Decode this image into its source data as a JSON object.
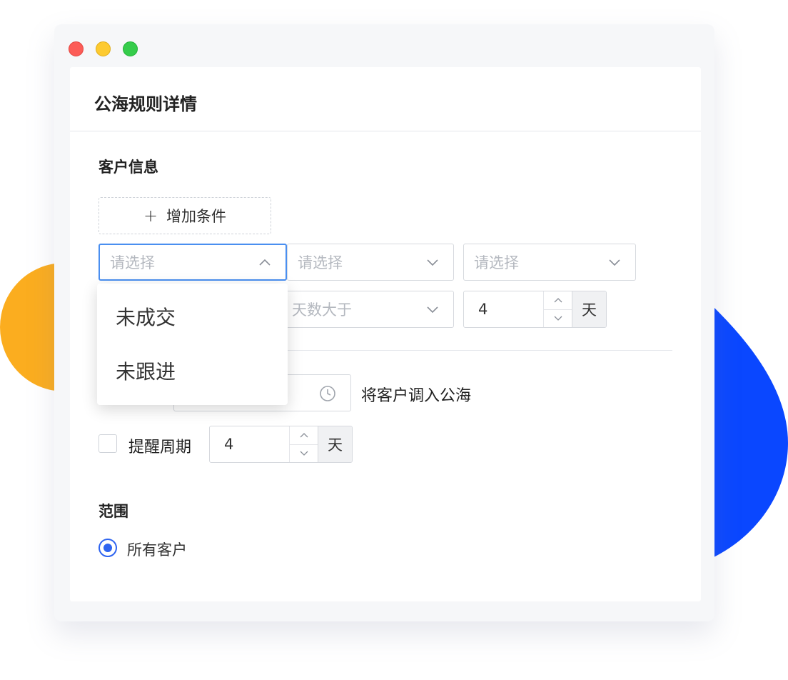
{
  "window": {
    "title": "公海规则详情"
  },
  "customer_section": {
    "title": "客户信息",
    "add_condition_label": "增加条件",
    "row1": {
      "select1_placeholder": "请选择",
      "select2_placeholder": "请选择",
      "select3_placeholder": "请选择"
    },
    "row2": {
      "select_placeholder": "天数大于",
      "days_value": "4",
      "unit": "天"
    }
  },
  "dropdown": {
    "options": [
      "未成交",
      "未跟进"
    ]
  },
  "rule": {
    "transfer_label": "将客户调入公海"
  },
  "reminder": {
    "label": "提醒周期",
    "value": "4",
    "unit": "天",
    "checked": false
  },
  "scope": {
    "title": "范围",
    "option_label": "所有客户",
    "selected": true
  },
  "colors": {
    "accent": "#2e64f0",
    "focus_border": "#4a8ff0",
    "orange_blob": "#fbad1f",
    "blue_blob": "#0a47ff"
  }
}
